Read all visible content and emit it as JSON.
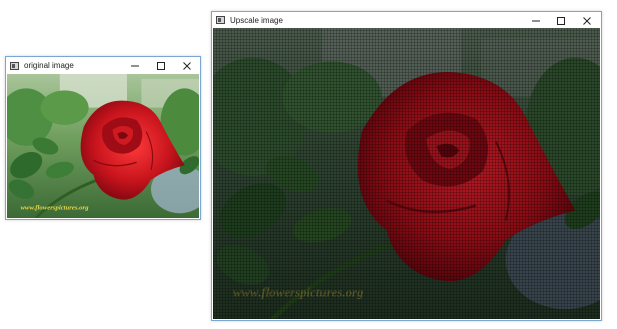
{
  "windows": {
    "original": {
      "title": "original image",
      "watermark": "www.flowerspictures.org"
    },
    "upscale": {
      "title": "Upscale image",
      "watermark": "www.flowerspictures.org"
    }
  },
  "icons": {
    "app": "window-app-icon",
    "minimize": "minimize-icon",
    "maximize": "maximize-icon",
    "close": "close-icon"
  },
  "colors": {
    "window_border": "#7aa6d6",
    "rose": "#c8141d",
    "foliage": "#3f8a3a"
  }
}
